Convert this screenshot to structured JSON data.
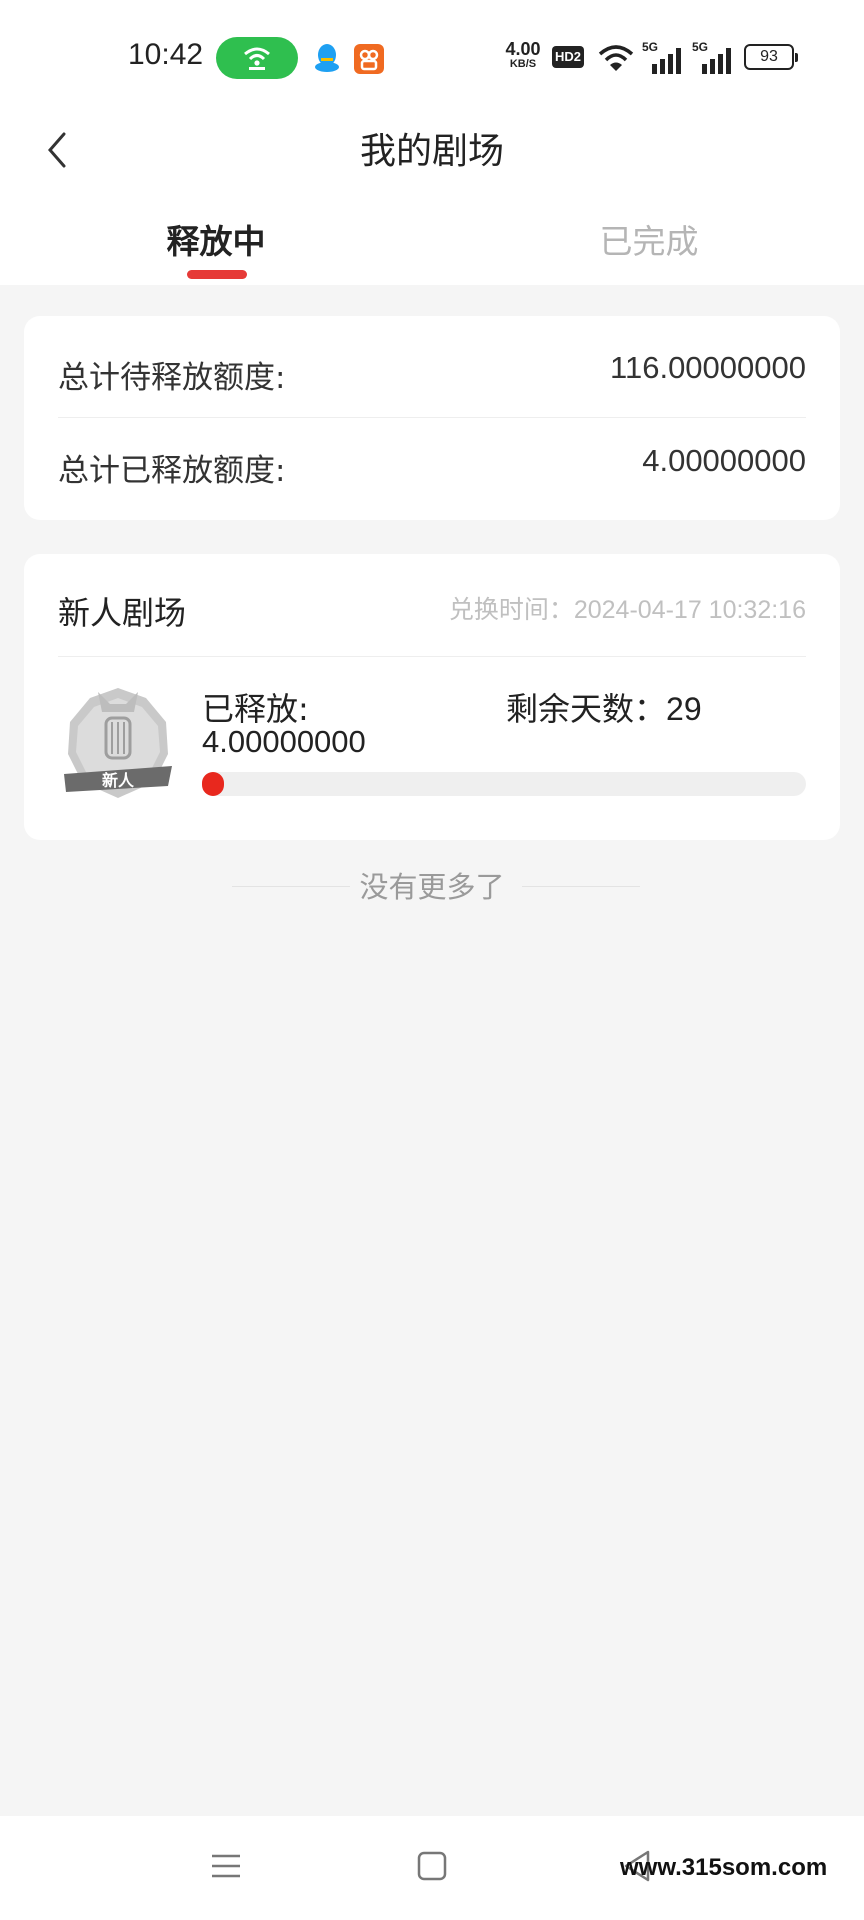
{
  "status_bar": {
    "time": "10:42",
    "net_speed_value": "4.00",
    "net_speed_unit": "KB/S",
    "hd_label": "HD2",
    "sim1_label": "5G",
    "sim2_label": "5G",
    "battery": "93",
    "icons": [
      "hotspot-icon",
      "qq-icon",
      "app-icon",
      "wifi-icon",
      "signal-icon",
      "battery-icon"
    ]
  },
  "header": {
    "title": "我的剧场",
    "tabs": [
      {
        "label": "释放中",
        "active": true
      },
      {
        "label": "已完成",
        "active": false
      }
    ]
  },
  "summary": {
    "pending_label": "总计待释放额度:",
    "pending_value": "116.00000000",
    "released_label": "总计已释放额度:",
    "released_value": "4.00000000"
  },
  "theater": {
    "name": "新人剧场",
    "exchange_time": "兑换时间：2024-04-17 10:32:16",
    "badge_text": "新人",
    "released_label": "已释放:",
    "released_value": "4.00000000",
    "days_left_label": "剩余天数：",
    "days_left_value": "29",
    "progress_ratio": 0.033
  },
  "footer": {
    "no_more": "没有更多了"
  },
  "nav": {
    "watermark": "www.315som.com"
  },
  "colors": {
    "accent": "#e63a37",
    "progress": "#e8281e",
    "background": "#f5f5f5",
    "muted_text": "#b5b5b5"
  }
}
